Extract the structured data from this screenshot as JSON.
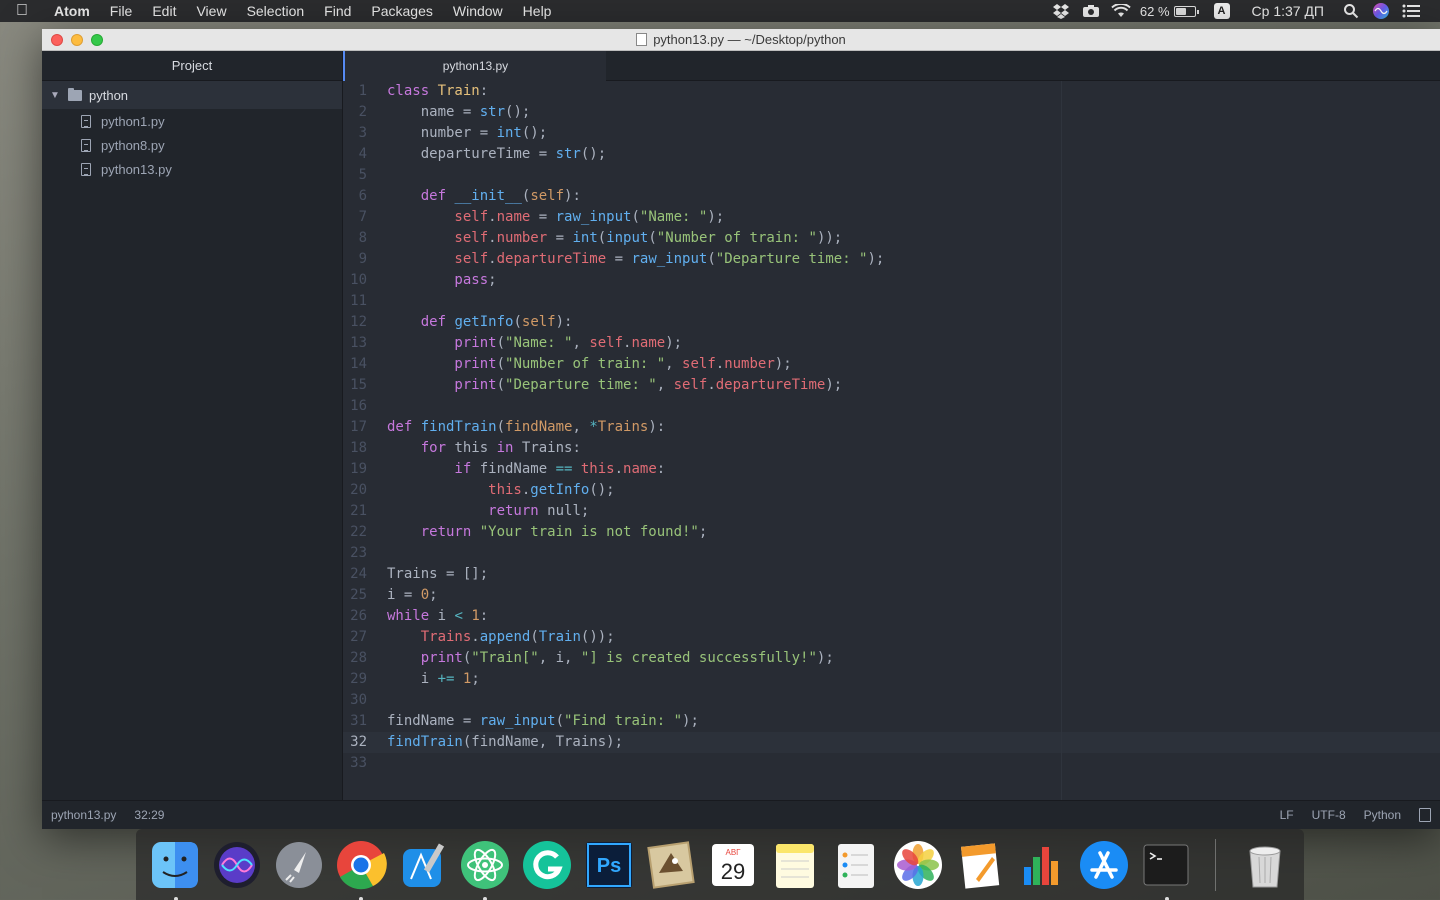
{
  "menubar": {
    "app_name": "Atom",
    "menus": [
      "File",
      "Edit",
      "View",
      "Selection",
      "Find",
      "Packages",
      "Window",
      "Help"
    ],
    "battery_percent": "62 %",
    "battery_level": 0.62,
    "input_source": "A",
    "clock": "Ср 1:37 ДП"
  },
  "window": {
    "title": "python13.py — ~/Desktop/python"
  },
  "tree": {
    "header": "Project",
    "root": "python",
    "files": [
      "python1.py",
      "python8.py",
      "python13.py"
    ]
  },
  "editor": {
    "active_tab": "python13.py",
    "cursor_line": 32,
    "lines": [
      [
        [
          "k",
          "class "
        ],
        [
          "c",
          "Train"
        ],
        [
          "p",
          ":"
        ]
      ],
      [
        [
          "p",
          "    name = "
        ],
        [
          "f",
          "str"
        ],
        [
          "p",
          "();"
        ]
      ],
      [
        [
          "p",
          "    number = "
        ],
        [
          "f",
          "int"
        ],
        [
          "p",
          "();"
        ]
      ],
      [
        [
          "p",
          "    departureTime = "
        ],
        [
          "f",
          "str"
        ],
        [
          "p",
          "();"
        ]
      ],
      [],
      [
        [
          "k",
          "    def "
        ],
        [
          "f",
          "__init__"
        ],
        [
          "p",
          "("
        ],
        [
          "n",
          "self"
        ],
        [
          "p",
          "):"
        ]
      ],
      [
        [
          "v",
          "        self"
        ],
        [
          "p",
          "."
        ],
        [
          "v",
          "name"
        ],
        [
          "p",
          " = "
        ],
        [
          "f",
          "raw_input"
        ],
        [
          "p",
          "("
        ],
        [
          "s",
          "\"Name: \""
        ],
        [
          "p",
          ");"
        ]
      ],
      [
        [
          "v",
          "        self"
        ],
        [
          "p",
          "."
        ],
        [
          "v",
          "number"
        ],
        [
          "p",
          " = "
        ],
        [
          "f",
          "int"
        ],
        [
          "p",
          "("
        ],
        [
          "f",
          "input"
        ],
        [
          "p",
          "("
        ],
        [
          "s",
          "\"Number of train: \""
        ],
        [
          "p",
          "));"
        ]
      ],
      [
        [
          "v",
          "        self"
        ],
        [
          "p",
          "."
        ],
        [
          "v",
          "departureTime"
        ],
        [
          "p",
          " = "
        ],
        [
          "f",
          "raw_input"
        ],
        [
          "p",
          "("
        ],
        [
          "s",
          "\"Departure time: \""
        ],
        [
          "p",
          ");"
        ]
      ],
      [
        [
          "k",
          "        pass"
        ],
        [
          "p",
          ";"
        ]
      ],
      [],
      [
        [
          "k",
          "    def "
        ],
        [
          "f",
          "getInfo"
        ],
        [
          "p",
          "("
        ],
        [
          "n",
          "self"
        ],
        [
          "p",
          "):"
        ]
      ],
      [
        [
          "k",
          "        print"
        ],
        [
          "p",
          "("
        ],
        [
          "s",
          "\"Name: \""
        ],
        [
          "p",
          ", "
        ],
        [
          "v",
          "self"
        ],
        [
          "p",
          "."
        ],
        [
          "v",
          "name"
        ],
        [
          "p",
          ");"
        ]
      ],
      [
        [
          "k",
          "        print"
        ],
        [
          "p",
          "("
        ],
        [
          "s",
          "\"Number of train: \""
        ],
        [
          "p",
          ", "
        ],
        [
          "v",
          "self"
        ],
        [
          "p",
          "."
        ],
        [
          "v",
          "number"
        ],
        [
          "p",
          ");"
        ]
      ],
      [
        [
          "k",
          "        print"
        ],
        [
          "p",
          "("
        ],
        [
          "s",
          "\"Departure time: \""
        ],
        [
          "p",
          ", "
        ],
        [
          "v",
          "self"
        ],
        [
          "p",
          "."
        ],
        [
          "v",
          "departureTime"
        ],
        [
          "p",
          ");"
        ]
      ],
      [],
      [
        [
          "k",
          "def "
        ],
        [
          "f",
          "findTrain"
        ],
        [
          "p",
          "("
        ],
        [
          "n",
          "findName"
        ],
        [
          "p",
          ", "
        ],
        [
          "o",
          "*"
        ],
        [
          "n",
          "Trains"
        ],
        [
          "p",
          "):"
        ]
      ],
      [
        [
          "k",
          "    for "
        ],
        [
          "p",
          "this "
        ],
        [
          "k",
          "in "
        ],
        [
          "p",
          "Trains:"
        ]
      ],
      [
        [
          "k",
          "        if "
        ],
        [
          "p",
          "findName "
        ],
        [
          "o",
          "=="
        ],
        [
          "p",
          " "
        ],
        [
          "v",
          "this"
        ],
        [
          "p",
          "."
        ],
        [
          "v",
          "name"
        ],
        [
          "p",
          ":"
        ]
      ],
      [
        [
          "v",
          "            this"
        ],
        [
          "p",
          "."
        ],
        [
          "f",
          "getInfo"
        ],
        [
          "p",
          "();"
        ]
      ],
      [
        [
          "k",
          "            return "
        ],
        [
          "p",
          "null;"
        ]
      ],
      [
        [
          "k",
          "    return "
        ],
        [
          "s",
          "\"Your train is not found!\""
        ],
        [
          "p",
          ";"
        ]
      ],
      [],
      [
        [
          "p",
          "Trains = [];"
        ]
      ],
      [
        [
          "p",
          "i = "
        ],
        [
          "n",
          "0"
        ],
        [
          "p",
          ";"
        ]
      ],
      [
        [
          "k",
          "while "
        ],
        [
          "p",
          "i "
        ],
        [
          "o",
          "<"
        ],
        [
          "p",
          " "
        ],
        [
          "n",
          "1"
        ],
        [
          "p",
          ":"
        ]
      ],
      [
        [
          "v",
          "    Trains"
        ],
        [
          "p",
          "."
        ],
        [
          "f",
          "append"
        ],
        [
          "p",
          "("
        ],
        [
          "f",
          "Train"
        ],
        [
          "p",
          "());"
        ]
      ],
      [
        [
          "k",
          "    print"
        ],
        [
          "p",
          "("
        ],
        [
          "s",
          "\"Train[\""
        ],
        [
          "p",
          ", i, "
        ],
        [
          "s",
          "\"] is created successfully!\""
        ],
        [
          "p",
          ");"
        ]
      ],
      [
        [
          "p",
          "    i "
        ],
        [
          "o",
          "+="
        ],
        [
          "p",
          " "
        ],
        [
          "n",
          "1"
        ],
        [
          "p",
          ";"
        ]
      ],
      [],
      [
        [
          "p",
          "findName = "
        ],
        [
          "f",
          "raw_input"
        ],
        [
          "p",
          "("
        ],
        [
          "s",
          "\"Find train: \""
        ],
        [
          "p",
          ");"
        ]
      ],
      [
        [
          "f",
          "findTrain"
        ],
        [
          "p",
          "(findName, Trains);"
        ]
      ],
      []
    ]
  },
  "statusbar": {
    "file": "python13.py",
    "position": "32:29",
    "line_ending": "LF",
    "encoding": "UTF-8",
    "grammar": "Python"
  },
  "dock": {
    "items": [
      {
        "name": "finder",
        "color": "#3d8ff0",
        "running": true
      },
      {
        "name": "siri",
        "color": "#5a3cc8",
        "running": false
      },
      {
        "name": "launchpad",
        "color": "#8a8f98",
        "running": false
      },
      {
        "name": "chrome",
        "color": "#e8453c",
        "running": true
      },
      {
        "name": "xcode",
        "color": "#1f8fe8",
        "running": false
      },
      {
        "name": "atom",
        "color": "#3fc27a",
        "running": true
      },
      {
        "name": "grammarly",
        "color": "#15c39a",
        "running": false
      },
      {
        "name": "photoshop",
        "color": "#0b1e3a",
        "running": false
      },
      {
        "name": "mail",
        "color": "#d8c8a0",
        "running": false
      },
      {
        "name": "calendar",
        "color": "#ffffff",
        "running": false
      },
      {
        "name": "notes",
        "color": "#fbe66a",
        "running": false
      },
      {
        "name": "reminders",
        "color": "#f4f4f4",
        "running": false
      },
      {
        "name": "photos",
        "color": "#f0a030",
        "running": false
      },
      {
        "name": "pages",
        "color": "#f39a2c",
        "running": false
      },
      {
        "name": "numbers",
        "color": "#2fb25a",
        "running": false
      },
      {
        "name": "app-store",
        "color": "#1a8cf5",
        "running": false
      },
      {
        "name": "terminal",
        "color": "#1c1c1c",
        "running": true
      }
    ],
    "calendar_month": "АВГ",
    "calendar_day": "29",
    "trash": {
      "name": "trash",
      "color": "#d8d8d8"
    }
  }
}
